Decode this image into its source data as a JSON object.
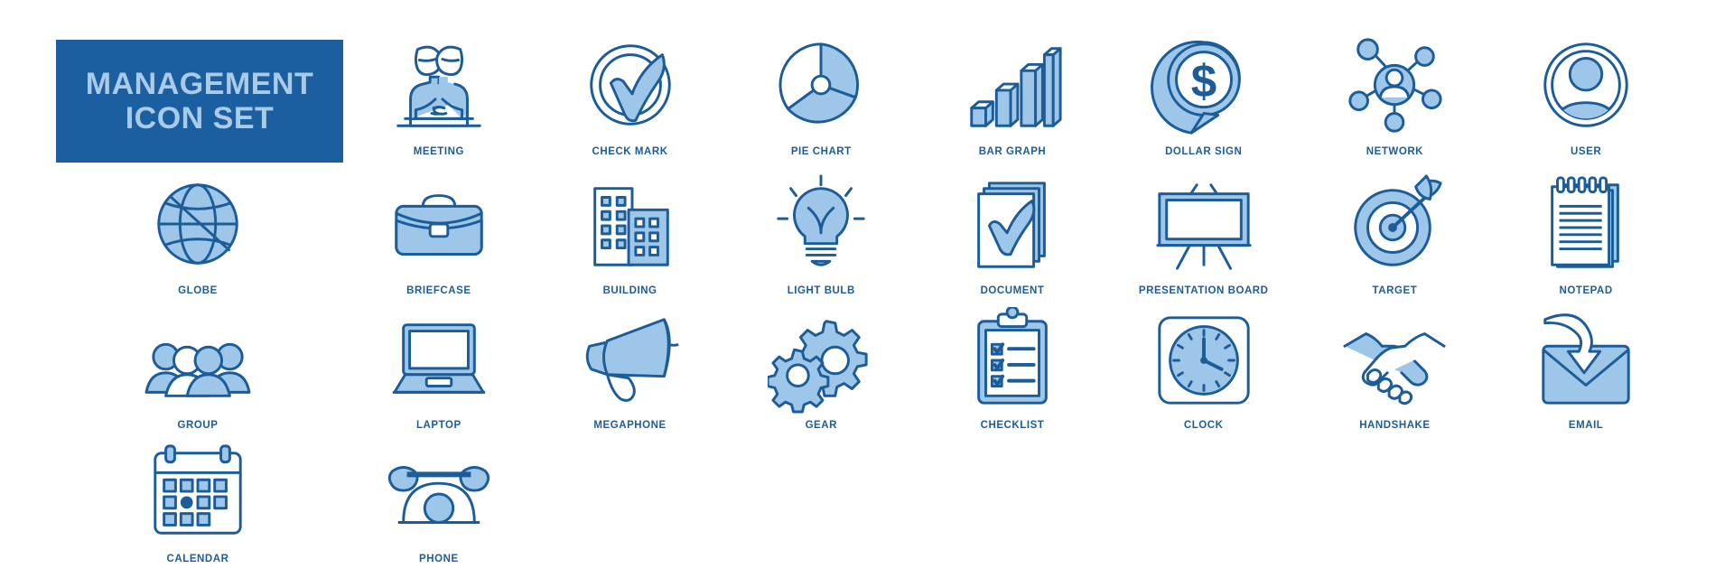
{
  "sheet": {
    "background": "#ffffff",
    "stroke_color": "#1c5d99",
    "fill_color": "#9dc6e8",
    "label_color": "#1c5d99",
    "title_box_color": "#1b5fa0",
    "title_text_color": "#a9cbe8"
  },
  "title": {
    "line1": "MANAGEMENT",
    "line2": "ICON SET"
  },
  "icons": [
    {
      "name": "meeting",
      "label": "MEETING",
      "glyph": "meeting-icon"
    },
    {
      "name": "check-mark",
      "label": "CHECK MARK",
      "glyph": "check-mark-icon"
    },
    {
      "name": "pie-chart",
      "label": "PIE CHART",
      "glyph": "pie-chart-icon"
    },
    {
      "name": "bar-graph",
      "label": "BAR GRAPH",
      "glyph": "bar-graph-icon"
    },
    {
      "name": "dollar-sign",
      "label": "DOLLAR SIGN",
      "glyph": "dollar-sign-icon"
    },
    {
      "name": "network",
      "label": "NETWORK",
      "glyph": "network-icon"
    },
    {
      "name": "user",
      "label": "USER",
      "glyph": "user-icon"
    },
    {
      "name": "globe",
      "label": "GLOBE",
      "glyph": "globe-icon"
    },
    {
      "name": "briefcase",
      "label": "BRIEFCASE",
      "glyph": "briefcase-icon"
    },
    {
      "name": "building",
      "label": "BUILDING",
      "glyph": "building-icon"
    },
    {
      "name": "light-bulb",
      "label": "LIGHT BULB",
      "glyph": "light-bulb-icon"
    },
    {
      "name": "document",
      "label": "DOCUMENT",
      "glyph": "document-icon"
    },
    {
      "name": "presentation-board",
      "label": "PRESENTATION BOARD",
      "glyph": "presentation-board-icon"
    },
    {
      "name": "target",
      "label": "TARGET",
      "glyph": "target-icon"
    },
    {
      "name": "notepad",
      "label": "NOTEPAD",
      "glyph": "notepad-icon"
    },
    {
      "name": "group",
      "label": "GROUP",
      "glyph": "group-icon"
    },
    {
      "name": "laptop",
      "label": "LAPTOP",
      "glyph": "laptop-icon"
    },
    {
      "name": "megaphone",
      "label": "MEGAPHONE",
      "glyph": "megaphone-icon"
    },
    {
      "name": "gear",
      "label": "GEAR",
      "glyph": "gear-icon"
    },
    {
      "name": "checklist",
      "label": "CHECKLIST",
      "glyph": "checklist-icon"
    },
    {
      "name": "clock",
      "label": "CLOCK",
      "glyph": "clock-icon"
    },
    {
      "name": "handshake",
      "label": "HANDSHAKE",
      "glyph": "handshake-icon"
    },
    {
      "name": "email",
      "label": "EMAIL",
      "glyph": "email-icon"
    },
    {
      "name": "calendar",
      "label": "CALENDAR",
      "glyph": "calendar-icon"
    },
    {
      "name": "phone",
      "label": "PHONE",
      "glyph": "phone-icon"
    }
  ]
}
